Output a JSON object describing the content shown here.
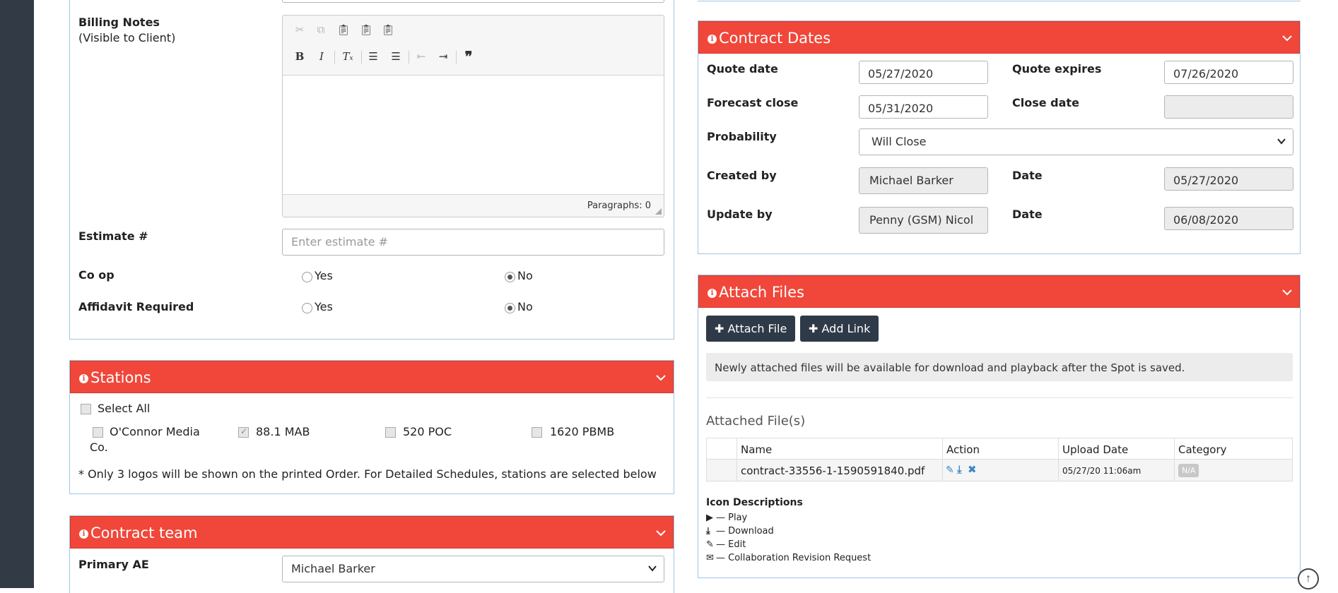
{
  "billing": {
    "label_line1": "Billing Notes",
    "label_line2": "(Visible to Client)",
    "status": "Paragraphs: 0",
    "estimate_label": "Estimate #",
    "estimate_placeholder": "Enter estimate #",
    "coop_label": "Co op",
    "affidavit_label": "Affidavit Required",
    "yes": "Yes",
    "no": "No"
  },
  "stations": {
    "title": "Stations",
    "select_all": "Select All",
    "items": [
      "O'Connor Media",
      "88.1 MAB",
      "520 POC",
      "1620 PBMB"
    ],
    "item0_cont": "Co.",
    "note": "* Only 3 logos will be shown on the printed Order. For Detailed Schedules, stations are selected below"
  },
  "team": {
    "title": "Contract team",
    "primary_label": "Primary AE",
    "primary_value": "Michael Barker"
  },
  "dates": {
    "title": "Contract Dates",
    "quote_date_label": "Quote date",
    "quote_date": "05/27/2020",
    "quote_expires_label": "Quote expires",
    "quote_expires": "07/26/2020",
    "forecast_label": "Forecast close",
    "forecast": "05/31/2020",
    "close_label": "Close date",
    "close": "",
    "probability_label": "Probability",
    "probability": "Will Close",
    "created_label": "Created by",
    "created_by": "Michael Barker",
    "date_label": "Date",
    "created_date": "05/27/2020",
    "update_label": "Update by",
    "update_by": "Penny (GSM) Nicol",
    "update_date": "06/08/2020"
  },
  "files": {
    "title": "Attach Files",
    "attach_btn": "Attach File",
    "link_btn": "Add Link",
    "notice": "Newly attached files will be available for download and playback after the Spot is saved.",
    "section": "Attached File(s)",
    "cols": [
      "Name",
      "Action",
      "Upload Date",
      "Category"
    ],
    "row": {
      "name": "contract-33556-1-1590591840.pdf",
      "date": "05/27/20 11:06am",
      "category": "N/A"
    },
    "icon_desc_title": "Icon Descriptions",
    "icon_desc": [
      "— Play",
      "— Download",
      "— Edit",
      "— Collaboration Revision Request"
    ]
  },
  "colors": {
    "accent": "#f0473a",
    "dark": "#2f3a48",
    "sidebar": "#323a45",
    "border": "#9fc6e6"
  },
  "icons": [
    "cut-icon",
    "copy-icon",
    "paste-icon",
    "bold-icon",
    "italic-icon",
    "list-icon",
    "quote-icon",
    "info-icon",
    "chevron-down-icon",
    "plus-icon",
    "edit-icon",
    "download-icon",
    "delete-icon",
    "play-icon",
    "envelope-icon",
    "scroll-up-icon"
  ]
}
